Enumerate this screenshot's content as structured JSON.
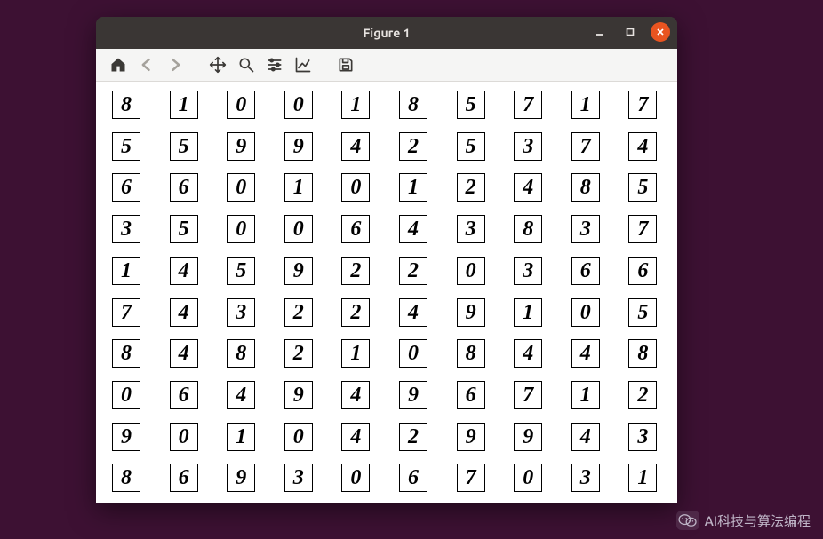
{
  "window": {
    "title": "Figure 1"
  },
  "toolbar": {
    "items": [
      {
        "name": "home-button",
        "icon": "home",
        "enabled": true
      },
      {
        "name": "back-button",
        "icon": "left",
        "enabled": false
      },
      {
        "name": "forward-button",
        "icon": "right",
        "enabled": false
      },
      {
        "name": "pan-button",
        "icon": "move",
        "enabled": true
      },
      {
        "name": "zoom-button",
        "icon": "zoom",
        "enabled": true
      },
      {
        "name": "subplots-button",
        "icon": "sliders",
        "enabled": true
      },
      {
        "name": "axes-edit-button",
        "icon": "chart",
        "enabled": true
      },
      {
        "name": "save-button",
        "icon": "save",
        "enabled": true
      }
    ]
  },
  "canvas": {
    "rows": 10,
    "cols": 10,
    "digits": [
      [
        "8",
        "1",
        "0",
        "0",
        "1",
        "8",
        "5",
        "7",
        "1",
        "7"
      ],
      [
        "5",
        "5",
        "9",
        "9",
        "4",
        "2",
        "5",
        "3",
        "7",
        "4"
      ],
      [
        "6",
        "6",
        "0",
        "1",
        "0",
        "1",
        "2",
        "4",
        "8",
        "5"
      ],
      [
        "3",
        "5",
        "0",
        "0",
        "6",
        "4",
        "3",
        "8",
        "3",
        "7"
      ],
      [
        "1",
        "4",
        "5",
        "9",
        "2",
        "2",
        "0",
        "3",
        "6",
        "6"
      ],
      [
        "7",
        "4",
        "3",
        "2",
        "2",
        "4",
        "9",
        "1",
        "0",
        "5"
      ],
      [
        "8",
        "4",
        "8",
        "2",
        "1",
        "0",
        "8",
        "4",
        "4",
        "8"
      ],
      [
        "0",
        "6",
        "4",
        "9",
        "4",
        "9",
        "6",
        "7",
        "1",
        "2"
      ],
      [
        "9",
        "0",
        "1",
        "0",
        "4",
        "2",
        "9",
        "9",
        "4",
        "3"
      ],
      [
        "8",
        "6",
        "9",
        "3",
        "0",
        "6",
        "7",
        "0",
        "3",
        "1"
      ]
    ]
  },
  "watermark": {
    "icon": "wechat-icon",
    "text": "AI科技与算法编程"
  },
  "colors": {
    "desktop_bg": "#3d1133",
    "titlebar_bg": "#3a3634",
    "close_btn": "#e95420",
    "toolbar_bg": "#f5f5f4",
    "canvas_bg": "#ffffff",
    "cell_border": "#000000"
  }
}
